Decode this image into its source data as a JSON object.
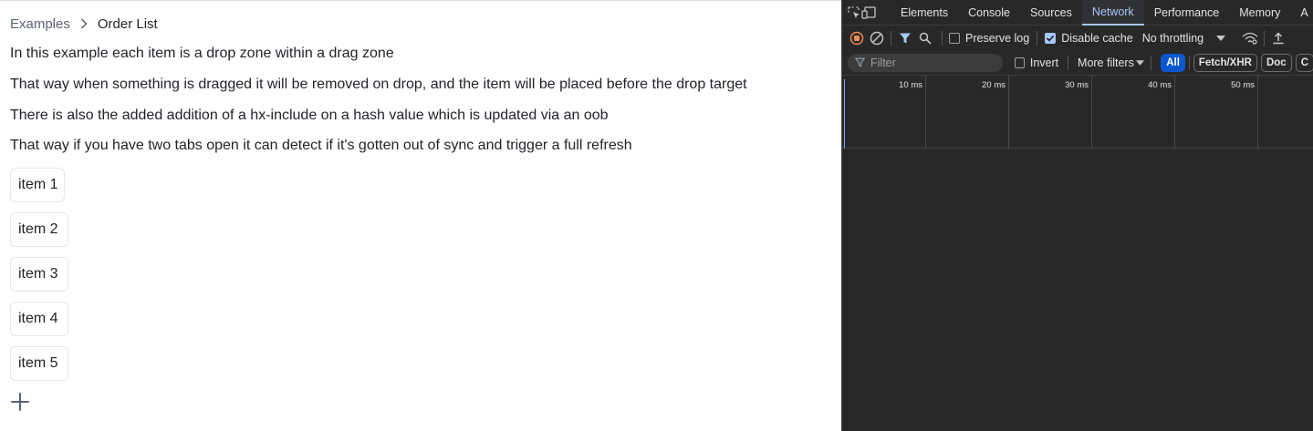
{
  "breadcrumb": {
    "parent": "Examples",
    "current": "Order List"
  },
  "paragraphs": [
    "In this example each item is a drop zone within a drag zone",
    "That way when something is dragged it will be removed on drop, and the item will be placed before the drop target",
    "There is also the added addition of a hx-include on a hash value which is updated via an oob",
    "That way if you have two tabs open it can detect if it's gotten out of sync and trigger a full refresh"
  ],
  "items": [
    "item 1",
    "item 2",
    "item 3",
    "item 4",
    "item 5"
  ],
  "add_icon": "plus-icon",
  "devtools": {
    "tabs": [
      "Elements",
      "Console",
      "Sources",
      "Network",
      "Performance",
      "Memory",
      "A"
    ],
    "active_tab": "Network",
    "toolbar": {
      "preserve_log": "Preserve log",
      "preserve_log_checked": false,
      "disable_cache": "Disable cache",
      "disable_cache_checked": true,
      "throttling": "No throttling"
    },
    "filter_bar": {
      "placeholder": "Filter",
      "invert": "Invert",
      "more_filters": "More filters",
      "types": [
        "All",
        "Fetch/XHR",
        "Doc",
        "C"
      ]
    },
    "timeline_ticks": [
      "10 ms",
      "20 ms",
      "30 ms",
      "40 ms",
      "50 ms"
    ],
    "colors": {
      "background": "#282828",
      "accent": "#a8c7fa",
      "record": "#f28b54",
      "active_pill": "#0b57d0"
    }
  }
}
